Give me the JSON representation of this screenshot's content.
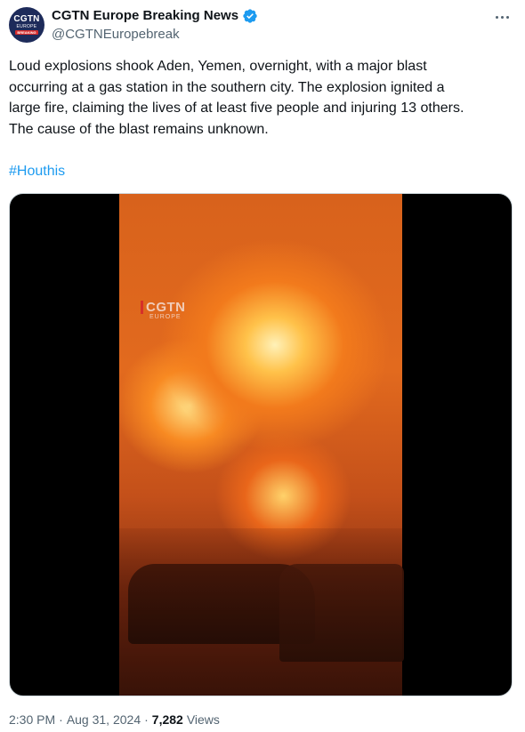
{
  "author": {
    "display_name": "CGTN Europe Breaking News",
    "handle": "@CGTNEuropebreak",
    "avatar_text": "CGTN",
    "avatar_sub": "EUROPE",
    "avatar_tag": "BREAKING",
    "verified": true
  },
  "tweet": {
    "text": "Loud explosions shook Aden, Yemen, overnight, with a major blast\noccurring at a gas station in the southern city. The explosion ignited a\nlarge fire, claiming the lives of at least five people and injuring 13 others.\nThe cause of the blast remains unknown.",
    "hashtag": "#Houthis"
  },
  "media": {
    "watermark_main": "CGTN",
    "watermark_sub": "EUROPE"
  },
  "meta": {
    "time": "2:30 PM",
    "separator": "·",
    "date": "Aug 31, 2024",
    "views_count": "7,282",
    "views_label": "Views"
  },
  "colors": {
    "accent": "#1d9bf0",
    "text": "#0f1419",
    "muted": "#536471"
  },
  "icons": {
    "verified": "verified-badge-icon",
    "more": "more-options-icon"
  }
}
